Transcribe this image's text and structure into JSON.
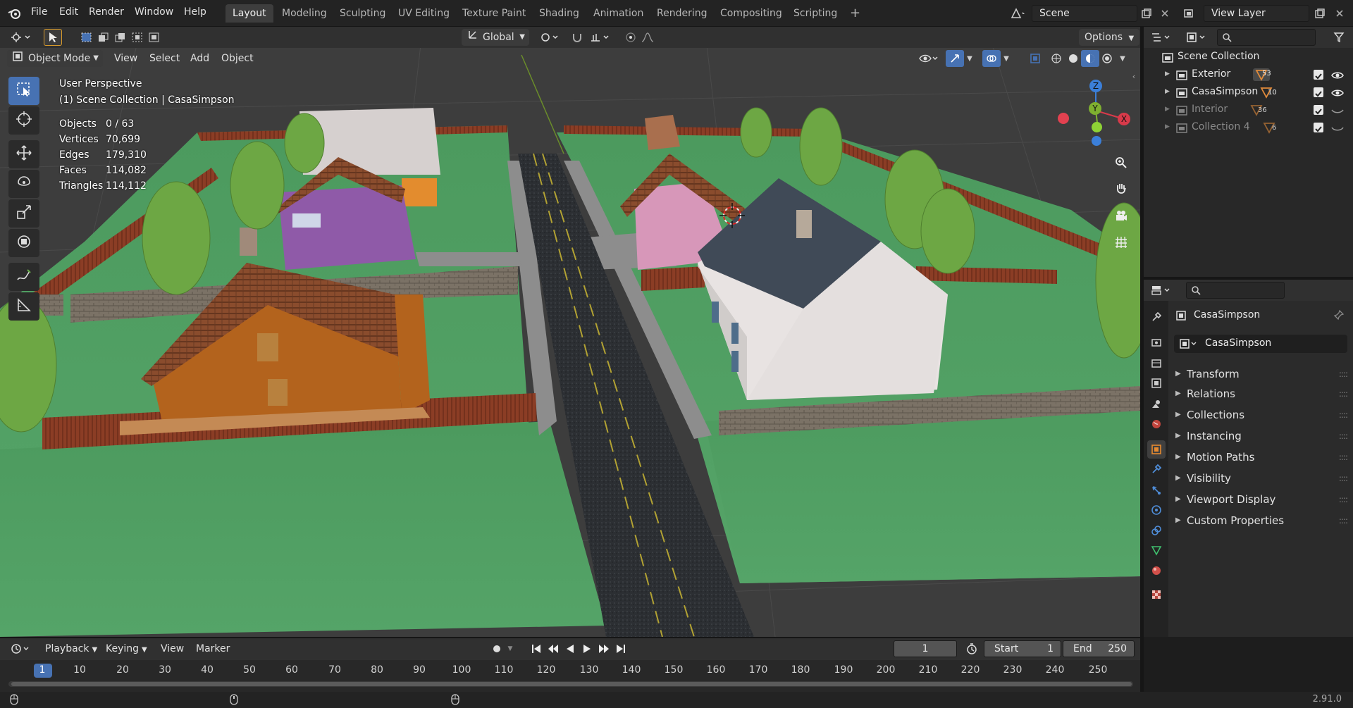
{
  "app": {
    "menus": [
      "File",
      "Edit",
      "Render",
      "Window",
      "Help"
    ],
    "workspaces": [
      "Layout",
      "Modeling",
      "Sculpting",
      "UV Editing",
      "Texture Paint",
      "Shading",
      "Animation",
      "Rendering",
      "Compositing",
      "Scripting"
    ],
    "active_workspace": "Layout",
    "add_workspace": "+",
    "scene_name": "Scene",
    "view_layer": "View Layer",
    "version": "2.91.0",
    "accent_color": "#4772b3"
  },
  "viewport_header": {
    "transform_orientation": "Global",
    "options_label": "Options",
    "mode": "Object Mode",
    "menus": [
      "View",
      "Select",
      "Add",
      "Object"
    ]
  },
  "overlay": {
    "perspective": "User Perspective",
    "collection_path": "(1) Scene Collection | CasaSimpson",
    "stats": [
      {
        "label": "Objects",
        "value": "0 / 63"
      },
      {
        "label": "Vertices",
        "value": "70,699"
      },
      {
        "label": "Edges",
        "value": "179,310"
      },
      {
        "label": "Faces",
        "value": "114,082"
      },
      {
        "label": "Triangles",
        "value": "114,112"
      }
    ]
  },
  "gizmo": {
    "z": "Z",
    "y": "Y",
    "x": "X"
  },
  "outliner": {
    "root": "Scene Collection",
    "items": [
      {
        "name": "Exterior",
        "count": "53",
        "dim": false
      },
      {
        "name": "CasaSimpson",
        "count": "10",
        "dim": false
      },
      {
        "name": "Interior",
        "count": "36",
        "dim": true
      },
      {
        "name": "Collection 4",
        "count": "6",
        "dim": true
      }
    ]
  },
  "properties": {
    "object_name": "CasaSimpson",
    "datablock": "CasaSimpson",
    "panels": [
      "Transform",
      "Relations",
      "Collections",
      "Instancing",
      "Motion Paths",
      "Visibility",
      "Viewport Display",
      "Custom Properties"
    ]
  },
  "timeline": {
    "menus": [
      "Playback",
      "Keying",
      "View",
      "Marker"
    ],
    "current_frame": "1",
    "start_label": "Start",
    "start": "1",
    "end_label": "End",
    "end": "250",
    "ticks": [
      "1",
      "10",
      "20",
      "30",
      "40",
      "50",
      "60",
      "70",
      "80",
      "90",
      "100",
      "110",
      "120",
      "130",
      "140",
      "150",
      "160",
      "170",
      "180",
      "190",
      "200",
      "210",
      "220",
      "230",
      "240",
      "250"
    ]
  }
}
